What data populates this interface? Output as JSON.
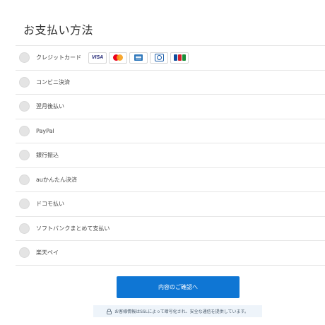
{
  "title": "お支払い方法",
  "methods": [
    {
      "label": "クレジットカード"
    },
    {
      "label": "コンビニ決済"
    },
    {
      "label": "翌月後払い"
    },
    {
      "label": "PayPal"
    },
    {
      "label": "銀行振込"
    },
    {
      "label": "auかんたん決済"
    },
    {
      "label": "ドコモ払い"
    },
    {
      "label": "ソフトバンクまとめて支払い"
    },
    {
      "label": "楽天ペイ"
    }
  ],
  "cards": {
    "visa": "VISA"
  },
  "confirm_label": "内容のご確認へ",
  "notice": "お客様情報はSSLによって暗号化され、安全な通信を提供しています。",
  "colors": {
    "accent": "#0f76d4",
    "notice_bg": "#eef4fa"
  }
}
